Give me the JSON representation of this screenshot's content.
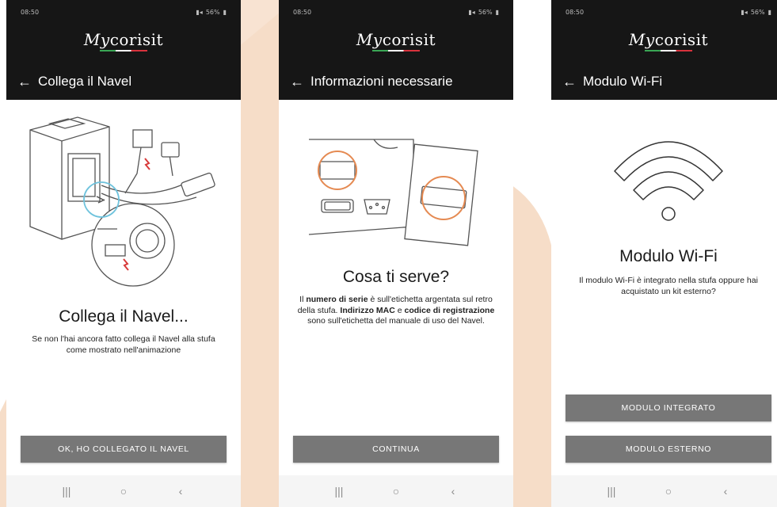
{
  "colors": {
    "background_shape": "#f6ddc8",
    "top_bar": "#161616",
    "button": "#777777",
    "accent_circle": "#e58a52",
    "highlight_circle": "#6fc3dd"
  },
  "status_bar": {
    "time": "08:50",
    "signal_text": "56%"
  },
  "brand": {
    "logo_my": "My",
    "logo_text": "corisit"
  },
  "screens": [
    {
      "title": "Collega il Navel",
      "heading": "Collega il Navel...",
      "description": "Se non l'hai ancora fatto collega il Navel alla stufa come mostrato nell'animazione",
      "illustration": "stove-connection-illustration",
      "buttons": [
        "OK, HO COLLEGATO IL NAVEL"
      ]
    },
    {
      "title": "Informazioni necessarie",
      "heading": "Cosa ti serve?",
      "description_parts": {
        "p1": "Il ",
        "b1": "numero di serie",
        "p2": " è sull'etichetta argentata sul retro della stufa.",
        "b2": "Indirizzo MAC",
        "p3": " e ",
        "b3": "codice di registrazione",
        "p4": " sono sull'etichetta del manuale di uso del Navel."
      },
      "illustration": "label-location-illustration",
      "buttons": [
        "CONTINUA"
      ]
    },
    {
      "title": "Modulo Wi-Fi",
      "heading": "Modulo Wi-Fi",
      "description": "Il modulo Wi-Fi è integrato nella stufa oppure hai acquistato un kit esterno?",
      "illustration": "wifi-icon",
      "buttons": [
        "MODULO INTEGRATO",
        "MODULO ESTERNO"
      ]
    }
  ],
  "nav": {
    "recent": "|||",
    "home": "○",
    "back": "‹"
  }
}
